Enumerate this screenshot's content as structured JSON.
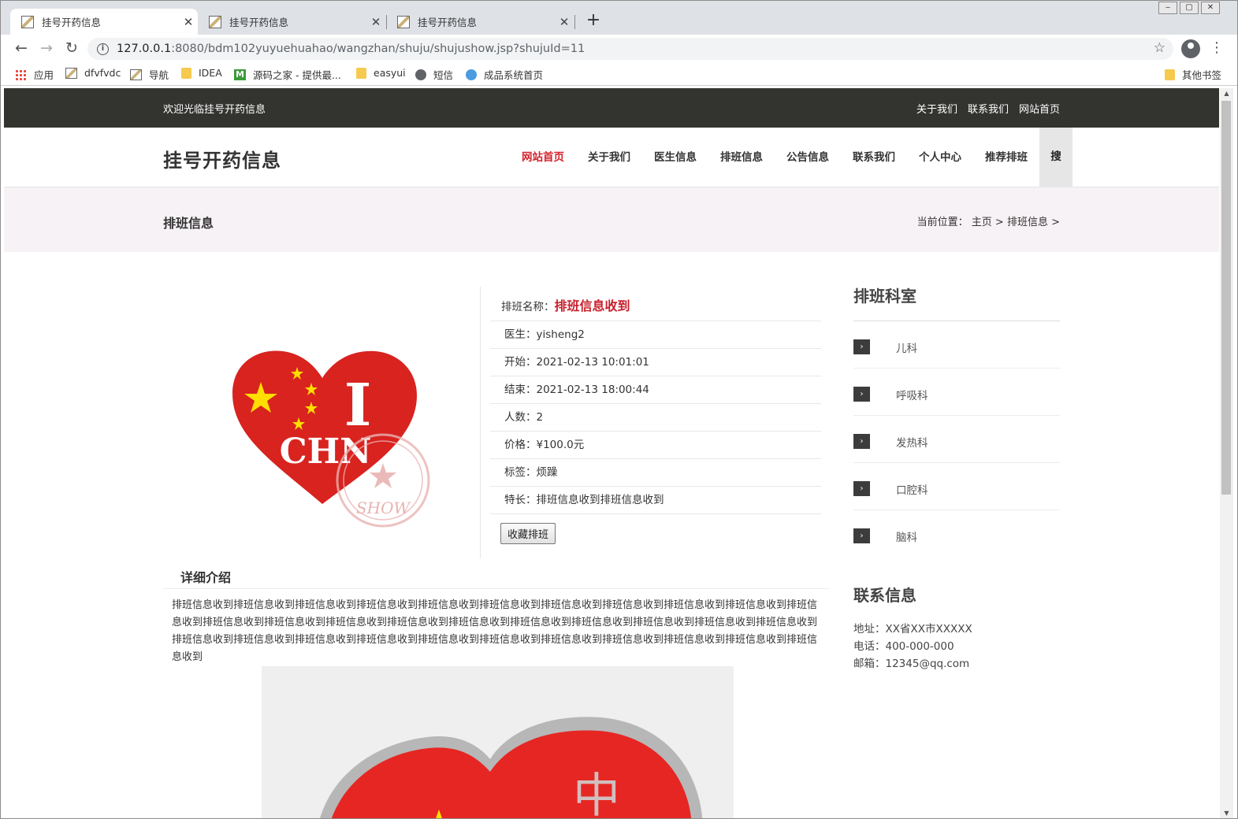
{
  "browser": {
    "tabs": [
      {
        "title": "挂号开药信息"
      },
      {
        "title": "挂号开药信息"
      },
      {
        "title": "挂号开药信息"
      }
    ],
    "url_host": "127.0.0.1",
    "url_path": ":8080/bdm102yuyuehuahao/wangzhan/shuju/shujushow.jsp?shujuId=11",
    "bookmarks": [
      {
        "label": "应用",
        "icon": "apps-icon"
      },
      {
        "label": "dfvfvdc",
        "icon": "image-icon"
      },
      {
        "label": "导航",
        "icon": "image-icon"
      },
      {
        "label": "IDEA",
        "icon": "folder-icon"
      },
      {
        "label": "源码之家 - 提供最...",
        "icon": "m-icon"
      },
      {
        "label": "easyui",
        "icon": "folder-icon"
      },
      {
        "label": "短信",
        "icon": "globe-icon"
      },
      {
        "label": "成品系统首页",
        "icon": "site-icon"
      }
    ],
    "other_bookmarks": "其他书签"
  },
  "topbar": {
    "welcome": "欢迎光临挂号开药信息",
    "links": [
      "关于我们",
      "联系我们",
      "网站首页"
    ]
  },
  "header": {
    "logo": "挂号开药信息",
    "nav": [
      "网站首页",
      "关于我们",
      "医生信息",
      "排班信息",
      "公告信息",
      "联系我们",
      "个人中心",
      "推荐排班"
    ],
    "search": "搜"
  },
  "pagebar": {
    "title": "排班信息",
    "crumb": "当前位置： 主页 > 排班信息 >"
  },
  "detail": {
    "name_label": "排班名称：",
    "name_value": "排班信息收到",
    "rows": [
      "医生：yisheng2",
      "开始：2021-02-13 10:01:01",
      "结束：2021-02-13 18:00:44",
      "人数：2",
      "价格：¥100.0元",
      "标签：烦躁",
      "特长：排班信息收到排班信息收到"
    ],
    "fav_button": "收藏排班",
    "intro_title": "详细介绍",
    "intro_text": "排班信息收到排班信息收到排班信息收到排班信息收到排班信息收到排班信息收到排班信息收到排班信息收到排班信息收到排班信息收到排班信息收到排班信息收到排班信息收到排班信息收到排班信息收到排班信息收到排班信息收到排班信息收到排班信息收到排班信息收到排班信息收到排班信息收到排班信息收到排班信息收到排班信息收到排班信息收到排班信息收到排班信息收到排班信息收到排班信息收到排班信息收到排班信息收到"
  },
  "sidebar": {
    "title": "排班科室",
    "items": [
      "儿科",
      "呼吸科",
      "发热科",
      "口腔科",
      "脑科"
    ],
    "contact_title": "联系信息",
    "contact": [
      "地址：XX省XX市XXXXX",
      "电话：400-000-000",
      "邮箱：12345@qq.com"
    ]
  },
  "image_text": {
    "heart_i": "I",
    "heart_chn": "CHN",
    "stamp": "SHOW"
  },
  "colors": {
    "accent": "#d4232d",
    "topbar": "#333330",
    "pagebar": "#f7f2f5"
  }
}
